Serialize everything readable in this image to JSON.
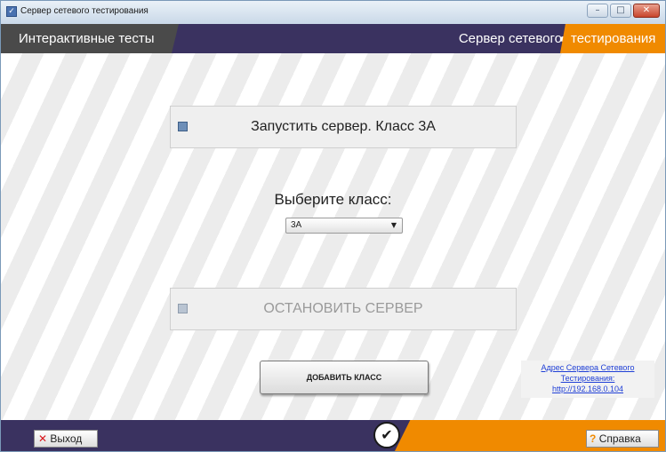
{
  "window": {
    "title": "Сервер сетевого тестирования",
    "minimize_glyph": "–",
    "maximize_glyph": "□",
    "close_glyph": "✕"
  },
  "header": {
    "left_tab_label": "Интерактивные тесты",
    "right_tab_part1": "Сервер сетевого",
    "right_tab_part2": "тестирования"
  },
  "main": {
    "start_button_label": "Запустить сервер. Класс 3А",
    "choose_class_label": "Выберите класс:",
    "class_select": {
      "selected": "3А"
    },
    "stop_button_label": "ОСТАНОВИТЬ СЕРВЕР",
    "add_class_button_label": "ДОБАВИТЬ КЛАСС",
    "server_address": {
      "line1": "Адрес Сервера Сетевого",
      "line2": "Тестирования:",
      "line3": "http://192.168.0.104"
    }
  },
  "footer": {
    "exit_icon_glyph": "✕",
    "exit_label": "Выход",
    "help_icon_glyph": "?",
    "help_label": "Справка",
    "logo_glyph": "✔"
  },
  "colors": {
    "header_bg": "#3a3260",
    "accent_orange": "#f08a00",
    "link_blue": "#1f3fd6"
  }
}
